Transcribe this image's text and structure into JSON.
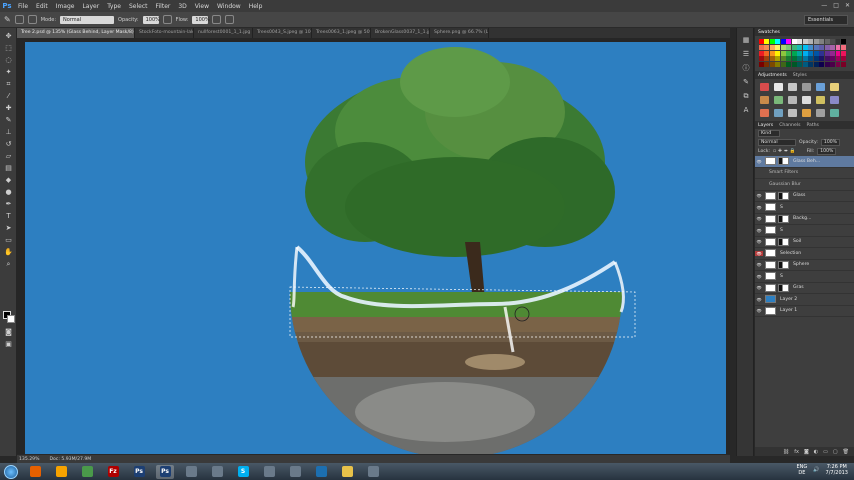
{
  "menubar": {
    "logo": "Ps",
    "items": [
      "File",
      "Edit",
      "Image",
      "Layer",
      "Type",
      "Select",
      "Filter",
      "3D",
      "View",
      "Window",
      "Help"
    ],
    "window_controls": [
      "—",
      "□",
      "✕"
    ]
  },
  "options": {
    "mode_label": "Mode:",
    "mode_value": "Normal",
    "opacity_label": "Opacity:",
    "opacity_value": "100%",
    "flow_label": "Flow:",
    "flow_value": "100%",
    "workspace": "Essentials"
  },
  "tabs": [
    {
      "label": "Tree 2.psd @ 135% (Glass Behind, Layer Mask/8) *",
      "active": true
    },
    {
      "label": "StockFoto-mountain-lake-00076_M.jpg @ ...",
      "active": false
    },
    {
      "label": "nullforest0001_1_1.jpg @ 33.3% ...",
      "active": false
    },
    {
      "label": "Trees0043_S.jpeg @ 100% (Layer 0...",
      "active": false
    },
    {
      "label": "Trees0063_1.jpeg @ 50% (Layer 0...",
      "active": false
    },
    {
      "label": "BrokenGlass0037_1_1.jpg @ 37.5...",
      "active": false
    },
    {
      "label": "Sphere.png @ 66.7% (Layer 0 cop...",
      "active": false
    }
  ],
  "status": {
    "zoom": "135.29%",
    "doc": "Doc: 5.93M/27.9M"
  },
  "colors": {
    "canvas_bg": "#2d7fc1",
    "selected_layer": "#5f7aa0",
    "accent_red": "#b23b3b"
  },
  "panels": {
    "swatches_tab": "Swatches",
    "adjustments_tab": "Adjustments",
    "styles_tab": "Styles",
    "layers_tabs": [
      "Layers",
      "Channels",
      "Paths"
    ],
    "kind_label": "Kind",
    "blend_mode": "Normal",
    "opacity_label": "Opacity:",
    "opacity_value": "100%",
    "lock_label": "Lock:",
    "fill_label": "Fill:",
    "fill_value": "100%"
  },
  "layers": [
    {
      "name": "Glass Beh...",
      "selected": true,
      "mask": true
    },
    {
      "name": "Smart Filters",
      "sub": true
    },
    {
      "name": "Gaussian Blur",
      "sub": true
    },
    {
      "name": "Glass",
      "mask": true
    },
    {
      "name": "S",
      "mask": false
    },
    {
      "name": "Backg...",
      "mask": true
    },
    {
      "name": "S",
      "mask": false
    },
    {
      "name": "Soil",
      "mask": true
    },
    {
      "name": "Selection",
      "red": true
    },
    {
      "name": "Sphere",
      "mask": true
    },
    {
      "name": "S",
      "mask": false
    },
    {
      "name": "Gras",
      "mask": true
    },
    {
      "name": "Layer 2",
      "mask": false,
      "blue": true
    },
    {
      "name": "Layer 1",
      "mask": false
    }
  ],
  "taskbar": {
    "apps": [
      "firefox",
      "fl",
      "paint",
      "filezilla",
      "ps",
      "ps",
      "misc",
      "misc",
      "skype",
      "misc",
      "misc",
      "media",
      "folder",
      "misc"
    ],
    "lang": "ENG",
    "region": "DE",
    "time": "7:26 PM",
    "date": "7/7/2013"
  }
}
